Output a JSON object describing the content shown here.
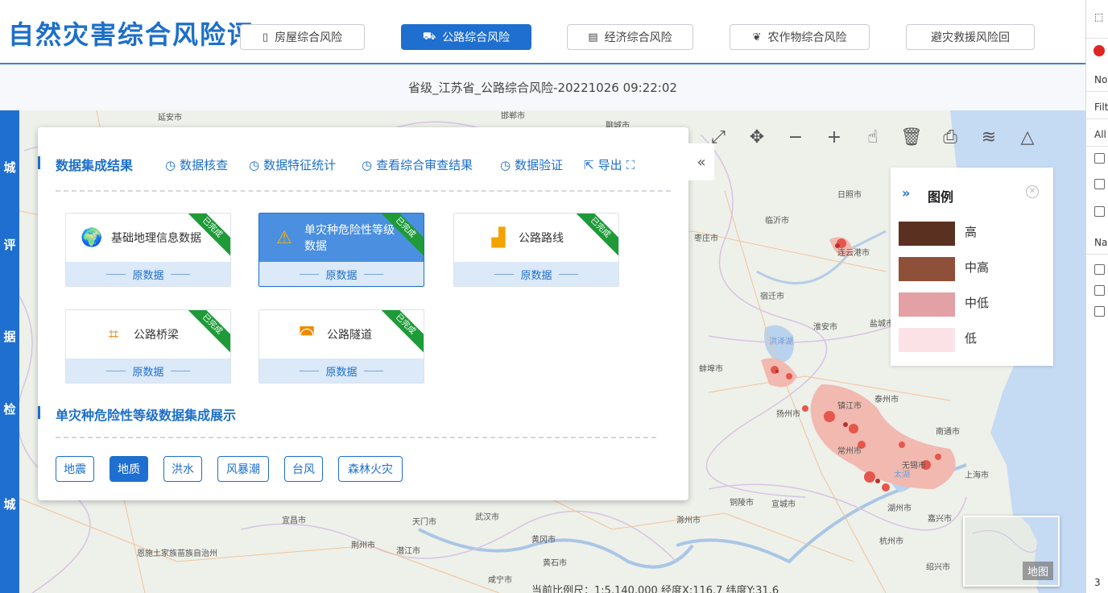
{
  "header": {
    "title": "自然灾害综合风险评",
    "tabs": [
      {
        "label": "房屋综合风险",
        "icon": "building-icon",
        "active": false
      },
      {
        "label": "公路综合风险",
        "icon": "road-icon",
        "active": true
      },
      {
        "label": "经济综合风险",
        "icon": "chart-icon",
        "active": false
      },
      {
        "label": "农作物综合风险",
        "icon": "crop-icon",
        "active": false
      },
      {
        "label": "避灾救援风险回",
        "icon": "return-icon",
        "active": false
      }
    ]
  },
  "subtitle": "省级_江苏省_公路综合风险-20221026 09:22:02",
  "sidebar": {
    "chars": [
      "城",
      "评",
      "据",
      "检",
      "城"
    ]
  },
  "panel": {
    "section1_title": "数据集成结果",
    "actions": [
      "数据核查",
      "数据特征统计",
      "查看综合审查结果",
      "数据验证",
      "导出"
    ],
    "cards": [
      {
        "label": "基础地理信息数据",
        "sub": "原数据",
        "badge": "已完成",
        "icon": "globe-icon",
        "active": false
      },
      {
        "label": "单灾种危险性等级数据",
        "sub": "原数据",
        "badge": "已完成",
        "icon": "warning-icon",
        "active": true
      },
      {
        "label": "公路路线",
        "sub": "原数据",
        "badge": "已完成",
        "icon": "road-route-icon",
        "active": false
      },
      {
        "label": "公路桥梁",
        "sub": "原数据",
        "badge": "已完成",
        "icon": "bridge-icon",
        "active": false
      },
      {
        "label": "公路隧道",
        "sub": "原数据",
        "badge": "已完成",
        "icon": "tunnel-icon",
        "active": false
      }
    ],
    "section2_title": "单灾种危险性等级数据集成展示",
    "hazards": [
      {
        "label": "地震",
        "active": false
      },
      {
        "label": "地质",
        "active": true
      },
      {
        "label": "洪水",
        "active": false
      },
      {
        "label": "风暴潮",
        "active": false
      },
      {
        "label": "台风",
        "active": false
      },
      {
        "label": "森林火灾",
        "active": false
      }
    ]
  },
  "legend": {
    "title": "图例",
    "items": [
      {
        "label": "高",
        "color": "#5a3120"
      },
      {
        "label": "中高",
        "color": "#8e5038"
      },
      {
        "label": "中低",
        "color": "#e4a1a5"
      },
      {
        "label": "低",
        "color": "#fbe2e6"
      }
    ]
  },
  "map_labels": [
    "延安市",
    "邯郸市",
    "聊城市",
    "临沂市",
    "日照市",
    "枣庄市",
    "连云港市",
    "宿迁市",
    "淮安市",
    "蚌埠市",
    "盐城市",
    "泰州市",
    "扬州市",
    "镇江市",
    "南通市",
    "常州市",
    "无锡市",
    "上海市",
    "宜昌市",
    "武汉市",
    "黄冈市",
    "荆州市",
    "潜江市",
    "天门市",
    "黄石市",
    "咸宁市",
    "铜陵市",
    "宣城市",
    "湖州市",
    "嘉兴市",
    "杭州市",
    "绍兴市",
    "滁州市",
    "恩施土家族苗族自治州",
    "洪泽湖",
    "太湖"
  ],
  "overview_label": "地图",
  "statusbar": "当前比例尺：1:5,140,000 经度X:116.7 纬度Y:31.6",
  "right_column": {
    "rows": [
      "No",
      "Filt",
      "All",
      "Na",
      "3"
    ]
  }
}
